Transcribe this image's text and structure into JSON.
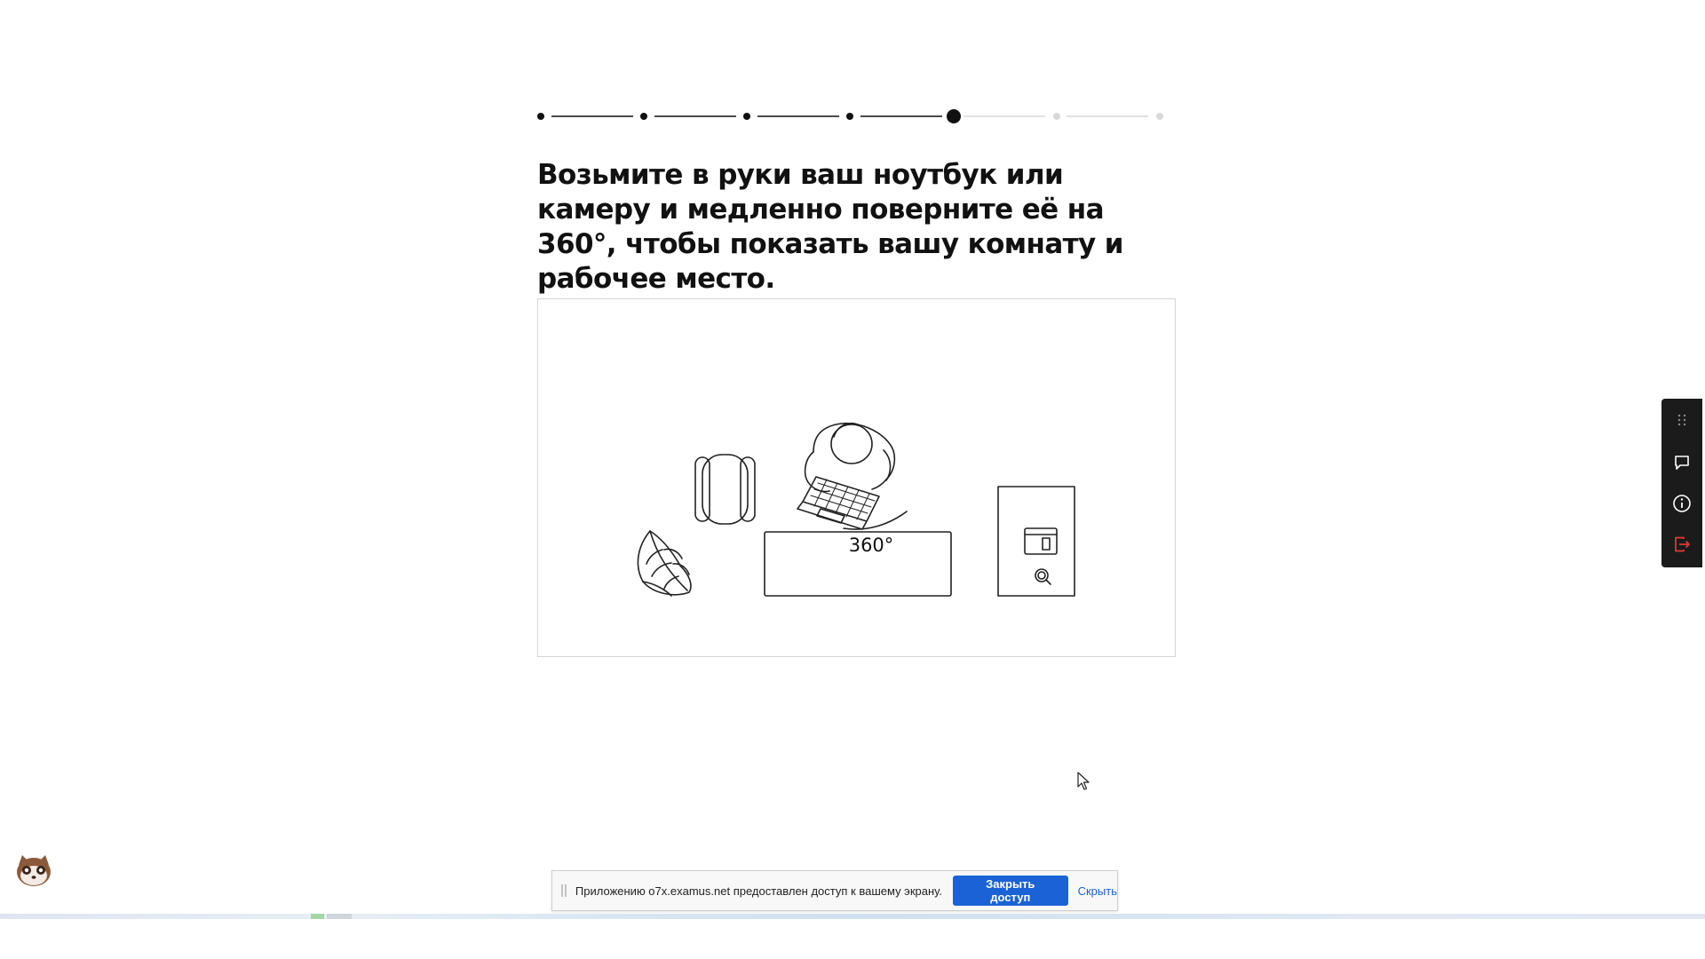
{
  "stepper": {
    "total_steps": 7,
    "current_step": 5
  },
  "instruction": {
    "title": "Возьмите в руки ваш ноутбук или камеру и медленно поверните её на 360°, чтобы показать вашу комнату и рабочее место."
  },
  "illustration": {
    "rotation_label": "360°"
  },
  "side_toolbar": {
    "icons": [
      "drag-handle-icon",
      "chat-icon",
      "info-icon",
      "exit-icon"
    ]
  },
  "share_bar": {
    "message": "Приложению o7x.examus.net предоставлен доступ к вашему экрану.",
    "stop_label": "Закрыть доступ",
    "hide_label": "Скрыть"
  },
  "colors": {
    "accent_blue": "#1a62d6",
    "toolbar_bg": "#1b1b1b",
    "exit_red": "#e53935"
  }
}
